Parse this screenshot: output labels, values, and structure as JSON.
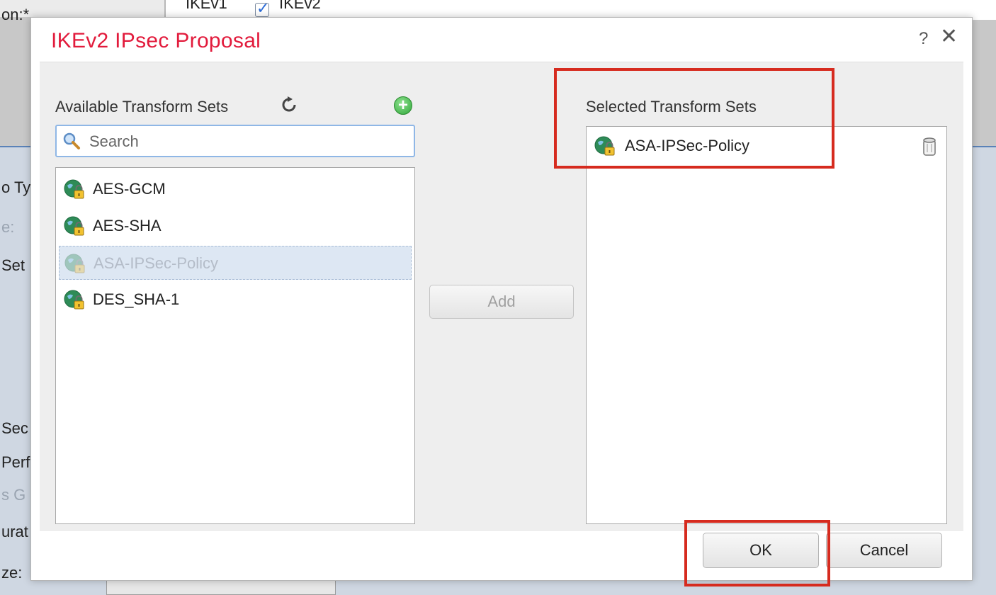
{
  "background": {
    "top_label": "on:*",
    "ikev1_label": "IKEv1",
    "ikev2_label": "IKEv2",
    "side_labels": [
      {
        "text": "o Ty",
        "dim": false
      },
      {
        "text": "e:",
        "dim": true
      },
      {
        "text": "Set",
        "dim": false
      },
      {
        "text": "Sec",
        "dim": false
      },
      {
        "text": "Perf",
        "dim": false
      },
      {
        "text": "s G",
        "dim": true
      },
      {
        "text": "urat",
        "dim": false
      },
      {
        "text": "ze:",
        "dim": false
      }
    ]
  },
  "dialog": {
    "title": "IKEv2 IPsec Proposal",
    "help": "?",
    "close": "✕",
    "available": {
      "label": "Available Transform Sets",
      "search_placeholder": "Search",
      "items": [
        {
          "label": "AES-GCM",
          "selected": false
        },
        {
          "label": "AES-SHA",
          "selected": false
        },
        {
          "label": "ASA-IPSec-Policy",
          "selected": true
        },
        {
          "label": "DES_SHA-1",
          "selected": false
        }
      ]
    },
    "add_label": "Add",
    "selected": {
      "label": "Selected Transform Sets",
      "items": [
        {
          "label": "ASA-IPSec-Policy"
        }
      ]
    },
    "ok_label": "OK",
    "cancel_label": "Cancel"
  },
  "colors": {
    "title": "#e21b3c",
    "highlight": "#d62b1f"
  }
}
